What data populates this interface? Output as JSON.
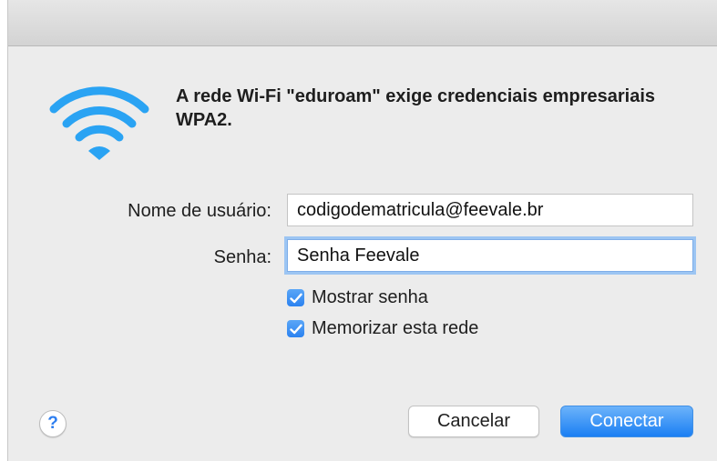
{
  "dialog": {
    "message": "A rede Wi-Fi \"eduroam\" exige credenciais empresariais WPA2."
  },
  "form": {
    "username_label": "Nome de usuário:",
    "username_value": "codigodematricula@feevale.br",
    "password_label": "Senha:",
    "password_value": "Senha Feevale"
  },
  "options": {
    "show_password": {
      "label": "Mostrar senha",
      "checked": true
    },
    "remember_network": {
      "label": "Memorizar esta rede",
      "checked": true
    }
  },
  "buttons": {
    "help": "?",
    "cancel": "Cancelar",
    "connect": "Conectar"
  },
  "icons": {
    "dialog_icon": "wifi-icon",
    "checkbox_mark": "checkmark-icon"
  },
  "colors": {
    "accent": "#2b82f0",
    "wifi": "#2aa3f3",
    "window_bg": "#ececec"
  }
}
